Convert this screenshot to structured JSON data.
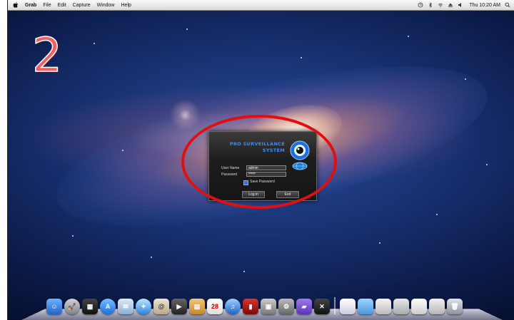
{
  "menubar": {
    "app_name": "Grab",
    "items": [
      "File",
      "Edit",
      "Capture",
      "Window",
      "Help"
    ],
    "clock": "Thu 10:20 AM"
  },
  "annotation": {
    "step_number": "2"
  },
  "login_dialog": {
    "brand_line1": "PRO SURVEILLANCE",
    "brand_line2": "SYSTEM",
    "username_label": "User Name",
    "username_value": "admin",
    "password_label": "Password",
    "password_value": "*****",
    "save_password_label": "Save Password",
    "save_password_checked": true,
    "login_button": "Log in",
    "exit_button": "Exit"
  },
  "dock": {
    "calendar_day": "28",
    "icons": [
      "finder-icon",
      "launchpad-icon",
      "mission-control-icon",
      "app-store-icon",
      "mail-icon",
      "safari-icon",
      "contacts-icon",
      "facetime-icon",
      "address-book-icon",
      "ical-icon",
      "itunes-icon",
      "photo-booth-icon",
      "preview-icon",
      "system-preferences-icon",
      "folder-icon",
      "x11-icon",
      "document-icon",
      "folder-icon",
      "window-icon",
      "window-icon",
      "window-icon",
      "window-icon",
      "trash-icon"
    ]
  },
  "colors": {
    "annotation_red": "#e11010",
    "brand_blue": "#3a8bff",
    "step_number": "#f06060"
  }
}
